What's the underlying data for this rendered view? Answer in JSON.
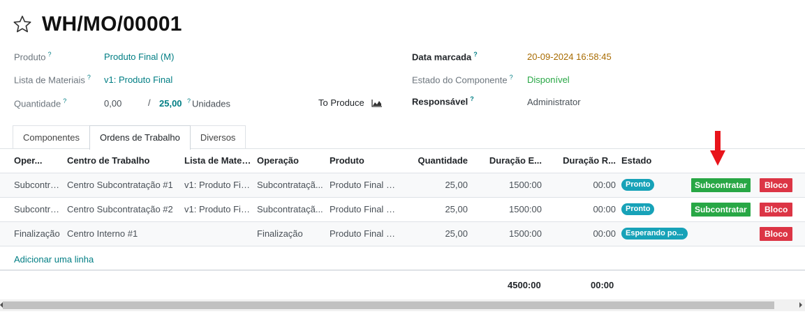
{
  "header": {
    "title": "WH/MO/00001"
  },
  "fields": {
    "produto": {
      "label": "Produto",
      "value": "Produto Final (M)"
    },
    "lista": {
      "label": "Lista de Materiais",
      "value": "v1: Produto Final"
    },
    "quantidade": {
      "label": "Quantidade",
      "produced": "0,00",
      "sep": "/",
      "total": "25,00",
      "uom": "Unidades"
    },
    "to_produce": {
      "label": "To Produce"
    },
    "data_marcada": {
      "label": "Data marcada",
      "value": "20-09-2024 16:58:45"
    },
    "estado_componente": {
      "label": "Estado do Componente",
      "value": "Disponível"
    },
    "responsavel": {
      "label": "Responsável",
      "value": "Administrator"
    },
    "help_mark": "?"
  },
  "tabs": [
    {
      "label": "Componentes"
    },
    {
      "label": "Ordens de Trabalho"
    },
    {
      "label": "Diversos"
    }
  ],
  "table": {
    "headers": [
      "Oper...",
      "Centro de Trabalho",
      "Lista de Mater...",
      "Operação",
      "Produto",
      "Quantidade",
      "Duração E...",
      "Duração R...",
      "Estado"
    ],
    "rows": [
      {
        "op": "Subcontra...",
        "centro": "Centro Subcontratação #1",
        "lista": "v1: Produto Final",
        "operacao": "Subcontrataçã...",
        "produto": "Produto Final (...",
        "qtd": "25,00",
        "dur_e": "1500:00",
        "dur_r": "00:00",
        "estado": "Pronto",
        "action": "Subcontratar",
        "block": "Bloco"
      },
      {
        "op": "Subcontra...",
        "centro": "Centro Subcontratação #2",
        "lista": "v1: Produto Final",
        "operacao": "Subcontrataçã...",
        "produto": "Produto Final (...",
        "qtd": "25,00",
        "dur_e": "1500:00",
        "dur_r": "00:00",
        "estado": "Pronto",
        "action": "Subcontratar",
        "block": "Bloco"
      },
      {
        "op": "Finalização",
        "centro": "Centro Interno #1",
        "lista": "",
        "operacao": "Finalização",
        "produto": "Produto Final (...",
        "qtd": "25,00",
        "dur_e": "1500:00",
        "dur_r": "00:00",
        "estado": "Esperando po...",
        "action": "",
        "block": "Bloco"
      }
    ],
    "add_line": "Adicionar uma linha",
    "totals": {
      "dur_e": "4500:00",
      "dur_r": "00:00"
    }
  },
  "colors": {
    "accent": "#017e84",
    "success": "#28a745",
    "danger": "#dc3545",
    "info": "#17a2b8",
    "arrow": "#e8141b"
  }
}
